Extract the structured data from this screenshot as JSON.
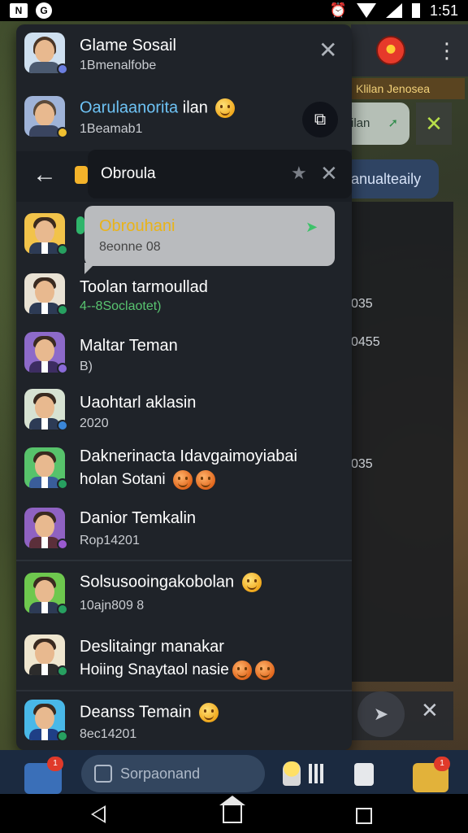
{
  "status_bar": {
    "time": "1:51",
    "left_icons": [
      "N",
      "G"
    ]
  },
  "background": {
    "banner_text": "Klilan Jenosea",
    "chip_text": "ilan",
    "pill_text": "anualteaily",
    "numbers": [
      "035",
      "0455",
      "035"
    ]
  },
  "panel": {
    "header": {
      "title": "Glame Sosail",
      "subtitle": "1Bmenalfobe"
    },
    "highlight": {
      "title_prefix": "Oarulaanorita",
      "title_suffix": " ilan",
      "subtitle": "1Beamab1"
    },
    "search_popup": {
      "label": "Obroula"
    },
    "tooltip": {
      "title": "Obrouhani",
      "subtitle": "8eonne 08"
    },
    "chats": [
      {
        "title": "Toolan tarmoullad",
        "subtitle": "4--8Soclaotet)",
        "badge_color": "#27a060"
      },
      {
        "title": "Maltar Teman",
        "subtitle": "B)",
        "badge_color": "#8a6ad8"
      },
      {
        "title": "Uaohtarl aklasin",
        "subtitle": "2020",
        "badge_color": "#3a86d8"
      },
      {
        "title": "Daknerinacta Idavgaimoyiabai",
        "subtitle": "holan Sotani",
        "badge_color": "#27a060"
      },
      {
        "title": "Danior Temkalin",
        "subtitle": "Rop14201",
        "badge_color": "#9a5ad0"
      },
      {
        "title": "Solsusooingakobolan",
        "subtitle": "10ajn809 8",
        "badge_color": "#27a060"
      },
      {
        "title": "Deslitaingr manakar",
        "subtitle": "Hoiing Snaytaol nasie",
        "badge_color": "#27a060"
      },
      {
        "title": "Deanss Temain",
        "subtitle": "8ec14201",
        "badge_color": "#27a060"
      }
    ]
  },
  "bottom_bar": {
    "search_placeholder": "Sorpaonand",
    "map_badge": "1",
    "chest_badge": "1"
  },
  "colors": {
    "accent_blue": "#6ec3f5",
    "tooltip_yellow": "#e9b318",
    "online_green": "#27a060"
  }
}
